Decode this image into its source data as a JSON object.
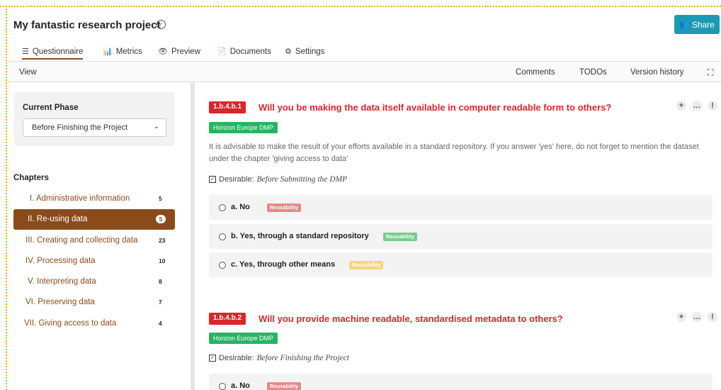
{
  "header": {
    "project_title": "My fantastic research project",
    "share_label": "Share",
    "colors": {
      "share": "#1b9bb1",
      "accent": "#8a4b1a"
    }
  },
  "tabs": [
    {
      "label": "Questionnaire",
      "icon": "list-icon",
      "active": true
    },
    {
      "label": "Metrics",
      "icon": "chart-icon",
      "active": false
    },
    {
      "label": "Preview",
      "icon": "eye-icon",
      "active": false
    },
    {
      "label": "Documents",
      "icon": "document-icon",
      "active": false
    },
    {
      "label": "Settings",
      "icon": "gears-icon",
      "active": false
    }
  ],
  "subbar": {
    "view": "View",
    "comments": "Comments",
    "todos": "TODOs",
    "version_history": "Version history"
  },
  "sidebar": {
    "phase_label": "Current Phase",
    "phase_value": "Before Finishing the Project",
    "chapters_label": "Chapters",
    "chapters": [
      {
        "label": "I. Administrative information",
        "count": "5"
      },
      {
        "label": "II. Re-using data",
        "count": "5",
        "active": true
      },
      {
        "label": "III. Creating and collecting data",
        "count": "23"
      },
      {
        "label": "IV. Processing data",
        "count": "10"
      },
      {
        "label": "V. Interpreting data",
        "count": "8"
      },
      {
        "label": "VI. Preserving data",
        "count": "7"
      },
      {
        "label": "VII. Giving access to data",
        "count": "4"
      }
    ]
  },
  "questions": [
    {
      "id": "1.b.4.b.1",
      "title": "Will you be making the data itself available in computer readable form to others?",
      "tag": "Horizon Europe DMP",
      "description": "It is advisable to make the result of your efforts available in a standard repository. If you answer 'yes' here, do not forget to mention the dataset under the chapter 'giving access to data'",
      "desirable_label": "Desirable:",
      "desirable_value": "Before Submitting the DMP",
      "answers": [
        {
          "label": "a. No",
          "badge": "Reusability",
          "badge_color": "#e38a8a"
        },
        {
          "label": "b. Yes, through a standard repository",
          "badge": "Reusability",
          "badge_color": "#7acc8a"
        },
        {
          "label": "c. Yes, through other means",
          "badge": "Reusability",
          "badge_color": "#f5d77a"
        }
      ]
    },
    {
      "id": "1.b.4.b.2",
      "title": "Will you provide machine readable, standardised metadata to others?",
      "tag": "Horizon Europe DMP",
      "desirable_label": "Desirable:",
      "desirable_value": "Before Finishing the Project",
      "answers": [
        {
          "label": "a. No",
          "badge": "Reusability",
          "badge_color": "#e38a8a"
        }
      ]
    }
  ]
}
